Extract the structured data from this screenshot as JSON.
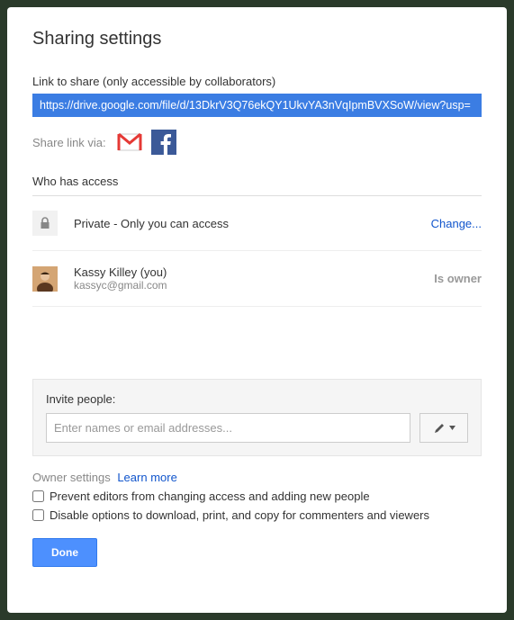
{
  "title": "Sharing settings",
  "link": {
    "label": "Link to share (only accessible by collaborators)",
    "value": "https://drive.google.com/file/d/13DkrV3Q76ekQY1UkvYA3nVqIpmBVXSoW/view?usp="
  },
  "shareVia": {
    "label": "Share link via:"
  },
  "access": {
    "heading": "Who has access",
    "privacy": "Private - Only you can access",
    "changeLabel": "Change...",
    "person": {
      "name": "Kassy Killey (you)",
      "email": "kassyc@gmail.com",
      "role": "Is owner"
    }
  },
  "invite": {
    "label": "Invite people:",
    "placeholder": "Enter names or email addresses..."
  },
  "ownerSettings": {
    "heading": "Owner settings",
    "learnMore": "Learn more",
    "opt1": "Prevent editors from changing access and adding new people",
    "opt2": "Disable options to download, print, and copy for commenters and viewers"
  },
  "done": "Done"
}
